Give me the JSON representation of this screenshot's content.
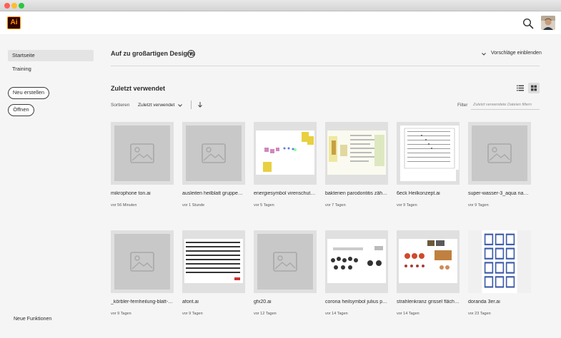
{
  "window": {
    "traffic_lights": [
      "#ff5f57",
      "#febc2e",
      "#28c840"
    ]
  },
  "app": {
    "logo_text": "Ai",
    "accent": "#ff9a00",
    "logo_bg": "#330000"
  },
  "header": {
    "search_icon": "search-icon",
    "avatar": "avatar"
  },
  "sidebar": {
    "items": [
      {
        "label": "Startseite",
        "active": true
      },
      {
        "label": "Training",
        "active": false
      }
    ],
    "new_button": "Neu erstellen",
    "open_button": "Öffnen",
    "footer_link": "Neue Funktionen"
  },
  "main": {
    "hero_title": "Auf zu großartigen Designs",
    "suggestions_label": "Vorschläge einblenden",
    "recent_title": "Zuletzt verwendet",
    "sort_label": "Sortieren",
    "sort_value": "Zuletzt verwendet",
    "filter_label": "Filter",
    "filter_placeholder": "Zuletzt verwendete Dateien filtern",
    "files": [
      {
        "name": "mikrophone ton.ai",
        "time": "vor 56 Minuten",
        "thumb": "placeholder"
      },
      {
        "name": "ausleiten heilblatt gruppen.ai",
        "time": "vor 1 Stunde",
        "thumb": "placeholder"
      },
      {
        "name": "energiesymbol virenschutz u...",
        "time": "vor 5 Tagen",
        "thumb": "art"
      },
      {
        "name": "bakterien parodontitis zähne...",
        "time": "vor 7 Tagen",
        "thumb": "art"
      },
      {
        "name": "6eck Heilkonzept.ai",
        "time": "vor 9 Tagen",
        "thumb": "art"
      },
      {
        "name": "super-wasser-3_aqua nabud...",
        "time": "vor 9 Tagen",
        "thumb": "placeholder"
      },
      {
        "name": "_körbler-fernheilung-blatt-au...",
        "time": "vor 9 Tagen",
        "thumb": "placeholder"
      },
      {
        "name": "afont.ai",
        "time": "vor 9 Tagen",
        "thumb": "art"
      },
      {
        "name": "gfx20.ai",
        "time": "vor 12 Tagen",
        "thumb": "placeholder"
      },
      {
        "name": "corona heilsymbol julius petr...",
        "time": "vor 14 Tagen",
        "thumb": "art"
      },
      {
        "name": "strahlenkranz grissel fläche.ai",
        "time": "vor 14 Tagen",
        "thumb": "art"
      },
      {
        "name": "doranda 3er.ai",
        "time": "vor 23 Tagen",
        "thumb": "art"
      }
    ]
  }
}
